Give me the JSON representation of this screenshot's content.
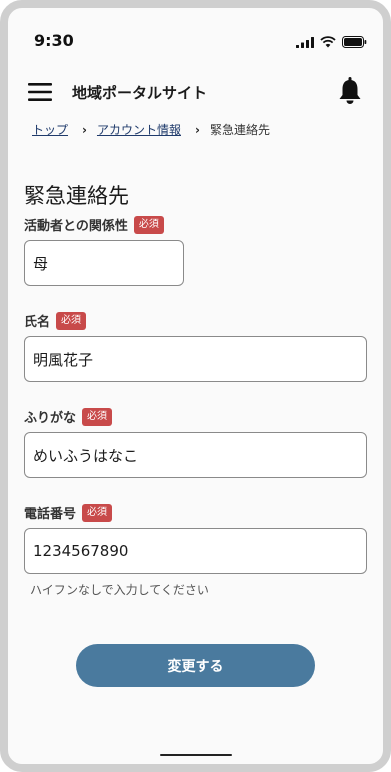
{
  "status_bar": {
    "time": "9:30"
  },
  "header": {
    "site_title": "地域ポータルサイト"
  },
  "breadcrumb": {
    "items": [
      "トップ",
      "アカウント情報",
      "緊急連絡先"
    ]
  },
  "page": {
    "title": "緊急連絡先"
  },
  "form": {
    "required_badge": "必須",
    "relationship": {
      "label": "活動者との関係性",
      "value": "母"
    },
    "name": {
      "label": "氏名",
      "value": "明風花子"
    },
    "furigana": {
      "label": "ふりがな",
      "value": "めいふうはなこ"
    },
    "phone": {
      "label": "電話番号",
      "value": "1234567890",
      "hint": "ハイフンなしで入力してください"
    },
    "submit_label": "変更する"
  },
  "colors": {
    "accent": "#4a7a9e",
    "required": "#c84a4a",
    "link": "#1f3a6b"
  }
}
